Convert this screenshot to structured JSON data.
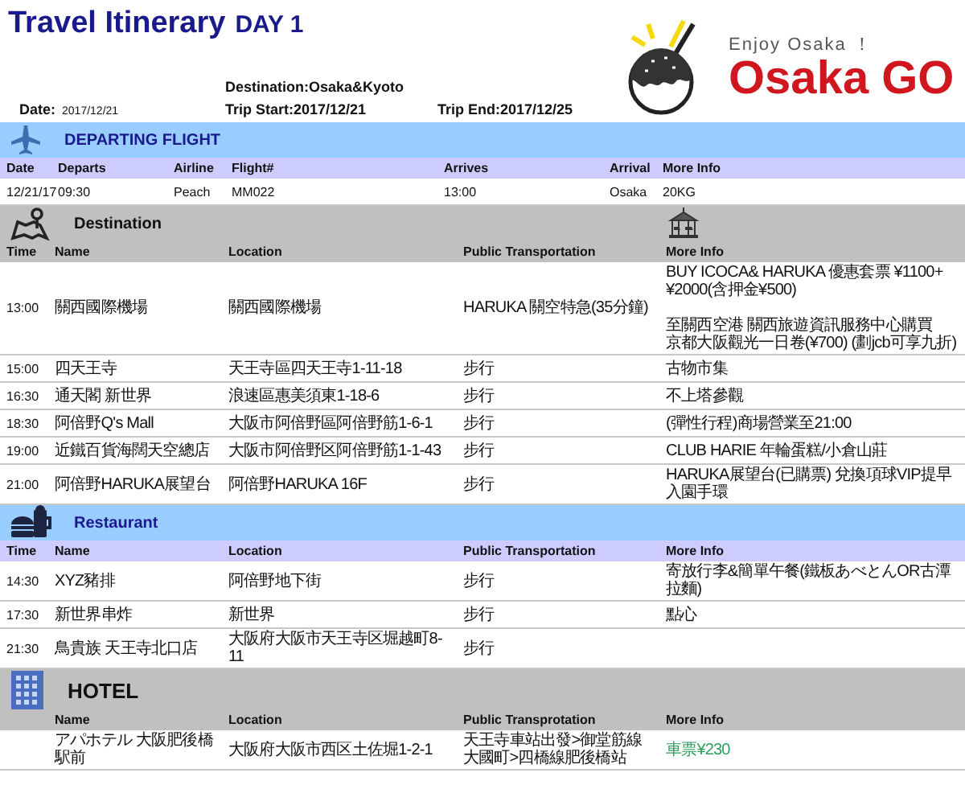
{
  "title": "Travel Itinerary",
  "day": "DAY 1",
  "logo": {
    "tagline": "Enjoy Osaka ！",
    "name": "Osaka GO"
  },
  "trip": {
    "destination": "Destination:Osaka&Kyoto",
    "date_label": "Date:",
    "date": "2017/12/21",
    "start": "Trip Start:2017/12/21",
    "end": "Trip End:2017/12/25"
  },
  "sections": [
    {
      "kind": "flight",
      "title": "DEPARTING FLIGHT",
      "columns": [
        "Date",
        "Departs",
        "Airline",
        "Flight#",
        "Arrives",
        "Arrival",
        "More Info"
      ],
      "rows": [
        {
          "cells": [
            "12/21/17",
            "09:30",
            "Peach",
            "MM022",
            "13:00",
            "Osaka",
            "20KG"
          ]
        }
      ]
    },
    {
      "kind": "destination",
      "title": "Destination",
      "columns": [
        "Time",
        "Name",
        "Location",
        "Public Transportation",
        "More Info"
      ],
      "rows": [
        {
          "cells": [
            "13:00",
            "關西國際機場",
            "關西國際機場",
            "HARUKA 關空特急(35分鐘)",
            {
              "paragraphs": [
                [
                  "BUY ICOCA& HARUKA 優惠套票 ¥1100+¥2000(含押金¥500)"
                ],
                [
                  "至關西空港 關西旅遊資訊服務中心購買",
                  "京都大阪觀光一日卷(¥700) (劃jcb可享九折)"
                ]
              ]
            }
          ]
        },
        {
          "cells": [
            "15:00",
            "四天王寺",
            "天王寺區四天王寺1-11-18",
            "步行",
            "古物市集"
          ]
        },
        {
          "cells": [
            "16:30",
            "通天閣 新世界",
            "浪速區惠美須東1-18-6",
            "步行",
            "不上塔參觀"
          ]
        },
        {
          "cells": [
            "18:30",
            "阿倍野Q's Mall",
            "大阪市阿倍野區阿倍野筋1-6-1",
            "步行",
            "(彈性行程)商場營業至21:00"
          ]
        },
        {
          "cells": [
            "19:00",
            "近鐵百貨海闊天空總店",
            "大阪市阿倍野区阿倍野筋1-1-43",
            "步行",
            "CLUB HARIE 年輪蛋糕/小倉山莊"
          ]
        },
        {
          "cells": [
            "21:00",
            "阿倍野HARUKA展望台",
            "阿倍野HARUKA 16F",
            "步行",
            "HARUKA展望台(已購票) 兌換項球VIP提早入園手環"
          ]
        }
      ]
    },
    {
      "kind": "restaurant",
      "title": "Restaurant",
      "columns": [
        "Time",
        "Name",
        "Location",
        "Public Transportation",
        "More Info"
      ],
      "rows": [
        {
          "cells": [
            "14:30",
            "XYZ豬排",
            "阿倍野地下街",
            "步行",
            "寄放行李&簡單午餐(鐵板あべとんOR古潭拉麵)"
          ]
        },
        {
          "cells": [
            "17:30",
            "新世界串炸",
            "新世界",
            "步行",
            "點心"
          ]
        },
        {
          "cells": [
            "21:30",
            "鳥貴族 天王寺北口店",
            "大阪府大阪市天王寺区堀越町8-11",
            "步行",
            ""
          ]
        }
      ]
    },
    {
      "kind": "hotel",
      "title": "HOTEL",
      "columns": [
        "",
        "Name",
        "Location",
        "Public Transprotation",
        "More Info"
      ],
      "rows": [
        {
          "cells": [
            "",
            "アパホテル 大阪肥後橋駅前",
            "大阪府大阪市西区土佐堀1-2-1",
            "天王寺車站出發>御堂筋線大國町>四橋線肥後橋站",
            {
              "text": "車票¥230",
              "color": "#2e9e5e"
            }
          ]
        }
      ]
    }
  ]
}
